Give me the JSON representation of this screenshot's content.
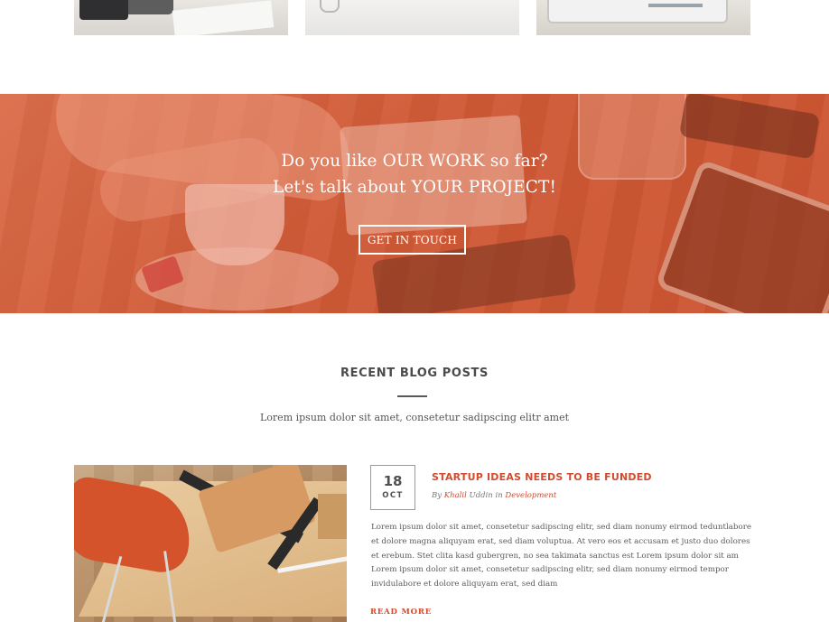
{
  "cta": {
    "line1": "Do you like OUR WORK so far?",
    "line2": "Let's talk about YOUR PROJECT!",
    "button_label": "GET IN TOUCH"
  },
  "blog": {
    "heading": "RECENT BLOG POSTS",
    "subheading": "Lorem ipsum dolor sit amet, consetetur sadipscing elitr amet",
    "post": {
      "date_day": "18",
      "date_month": "OCT",
      "title": "STARTUP IDEAS NEEDS TO BE FUNDED",
      "meta_by": "By",
      "author_first": "Khalil",
      "author_last": "Uddin",
      "meta_in": "in",
      "category": "Development",
      "excerpt": "Lorem ipsum dolor sit amet, consetetur sadipscing elitr, sed diam nonumy eirmod teduntlabore et dolore magna aliquyam erat, sed diam voluptua. At vero eos et accusam et justo duo dolores et erebum. Stet clita kasd gubergren, no sea takimata sanctus est Lorem ipsum dolor sit am Lorem ipsum dolor sit amet, consetetur sadipscing elitr, sed diam nonumy eirmod tempor invidulabore et dolore aliquyam erat, sed diam",
      "read_more": "READ MORE"
    }
  },
  "colors": {
    "accent": "#d34a2c",
    "cta_overlay": "#d45f3b",
    "heading_text": "#4b4b4b"
  }
}
